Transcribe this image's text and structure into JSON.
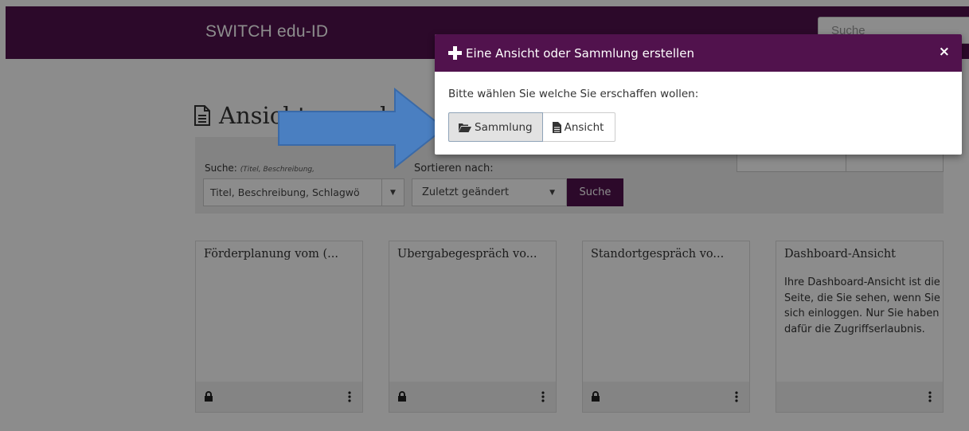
{
  "header": {
    "brand": "SWITCH edu-ID",
    "search_placeholder": "Suche"
  },
  "page": {
    "title": "Ansichten und Sammlungen",
    "title_visible": "Ansichten und Sa"
  },
  "filters": {
    "search_label": "Suche:",
    "search_hint": "(Titel, Beschreibung,",
    "search_field_value": "Titel, Beschreibung, Schlagwö",
    "sort_label": "Sortieren nach:",
    "sort_value": "Zuletzt geändert",
    "search_button": "Suche"
  },
  "cards": [
    {
      "title": "Förderplanung vom (...",
      "description": ""
    },
    {
      "title": "Übergabegespräch vo...",
      "description": ""
    },
    {
      "title": "Standortgespräch vo...",
      "description": ""
    },
    {
      "title": "Dashboard-Ansicht",
      "description": "Ihre Dashboard-Ansicht ist die Seite, die Sie sehen, wenn Sie sich einloggen. Nur Sie haben dafür die Zugriffserlaubnis."
    }
  ],
  "modal": {
    "title": "Eine Ansicht oder Sammlung erstellen",
    "close": "×",
    "prompt": "Bitte wählen Sie welche Sie erschaffen wollen:",
    "collection_button": "Sammlung",
    "view_button": "Ansicht"
  },
  "colors": {
    "brand": "#51124d",
    "arrow": "#4a7fc1",
    "overlay": "rgba(0,0,0,0.45)"
  }
}
